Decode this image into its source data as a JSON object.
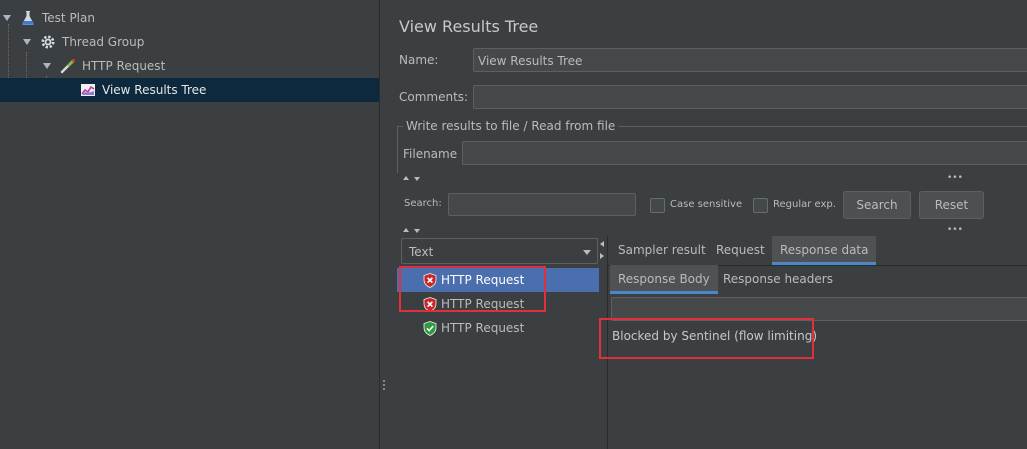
{
  "tree": {
    "items": [
      {
        "label": "Test Plan",
        "icon": "flask-icon"
      },
      {
        "label": "Thread Group",
        "icon": "gear-icon"
      },
      {
        "label": "HTTP Request",
        "icon": "pipette-icon"
      },
      {
        "label": "View Results Tree",
        "icon": "graph-icon"
      }
    ]
  },
  "panel": {
    "title": "View Results Tree",
    "name_label": "Name:",
    "name_value": "View Results Tree",
    "comments_label": "Comments:",
    "comments_value": "",
    "write_results_group": "Write results to file / Read from file",
    "filename_label": "Filename",
    "filename_value": ""
  },
  "search": {
    "label": "Search:",
    "value": "",
    "case_sensitive": "Case sensitive",
    "regular_exp": "Regular exp.",
    "search_button": "Search",
    "reset_button": "Reset"
  },
  "results": {
    "renderer": "Text",
    "items": [
      {
        "label": "HTTP Request",
        "status": "error",
        "selected": true
      },
      {
        "label": "HTTP Request",
        "status": "error",
        "selected": false
      },
      {
        "label": "HTTP Request",
        "status": "success",
        "selected": false
      }
    ]
  },
  "detail": {
    "tabs": [
      "Sampler result",
      "Request",
      "Response data"
    ],
    "active_tab": "Response data",
    "subtabs": [
      "Response Body",
      "Response headers"
    ],
    "active_subtab": "Response Body",
    "body_text": "Blocked by Sentinel (flow limiting)"
  },
  "colors": {
    "background": "#3c3f41",
    "selection_tree": "#0d293e",
    "selection_list": "#4b6eaf",
    "highlight_box": "#e0303b",
    "error_shield": "#c62828",
    "success_shield": "#2e9b3a"
  }
}
